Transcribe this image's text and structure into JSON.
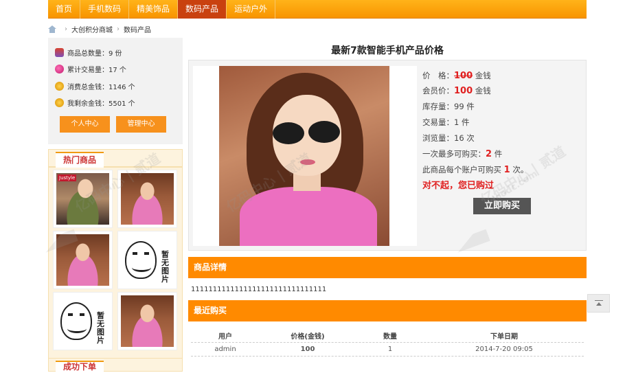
{
  "nav": {
    "items": [
      "首页",
      "手机数码",
      "精美饰品",
      "数码产品",
      "运动户外"
    ],
    "active_index": 3
  },
  "breadcrumb": {
    "home": "大创积分商城",
    "current": "数码产品"
  },
  "stats": {
    "total_goods": "商品总数量：9 份",
    "total_trades": "累计交易量：17 个",
    "total_spent": "消费总金钱：1146 个",
    "remaining": "我剩余金钱：5501 个"
  },
  "buttons": {
    "personal_center": "个人中心",
    "admin_center": "管理中心",
    "buy_now": "立即购买"
  },
  "hot": {
    "title": "热门商品",
    "no_image_text": "暂无图片",
    "brand_tag": "Justyle"
  },
  "success": {
    "title": "成功下单"
  },
  "product": {
    "title": "最新7款智能手机产品价格",
    "price_label": "价　格：",
    "price_value": "100",
    "price_unit": "金钱",
    "member_price_label": "会员价：",
    "member_price_value": "100",
    "member_price_unit": "金钱",
    "stock": "库存量：99 件",
    "trades": "交易量：1 件",
    "views": "浏览量：16 次",
    "max_buy_prefix": "一次最多可购买：",
    "max_buy_value": "2",
    "max_buy_suffix": " 件",
    "per_account_prefix": "此商品每个账户可购买",
    "per_account_value": "1",
    "per_account_suffix": " 次。",
    "sorry": "对不起，您已购过"
  },
  "sections": {
    "detail": "商品详情",
    "recent": "最近购买"
  },
  "detail_text": "1111111111111111111111111111111",
  "recent_table": {
    "headers": [
      "用户",
      "价格(金钱)",
      "数量",
      "下单日期"
    ],
    "rows": [
      [
        "admin",
        "100",
        "1",
        "2014-7-20 09:05"
      ]
    ]
  },
  "watermark": {
    "text": "亿码中心 | 贰道",
    "text2": "adoodc.com"
  },
  "colors": {
    "nav": "#f89400",
    "nav_active": "#c9410f",
    "accent": "#ff8a00",
    "price": "#e02020"
  }
}
